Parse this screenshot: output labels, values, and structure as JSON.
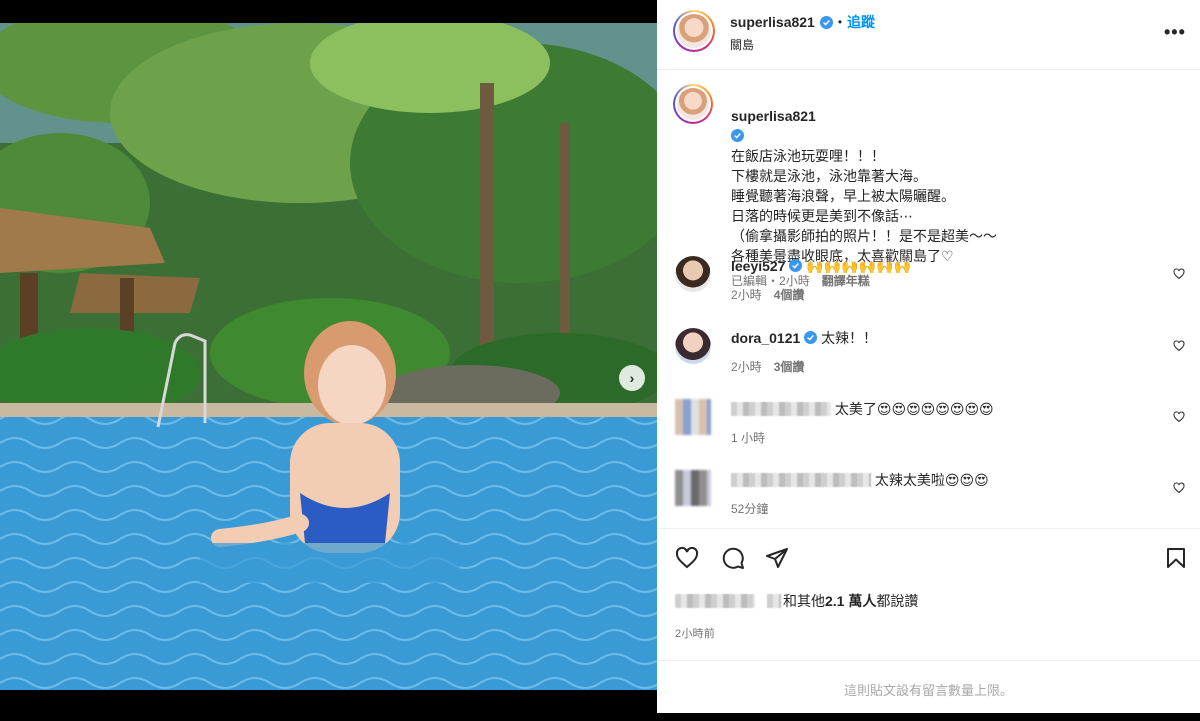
{
  "author": {
    "username": "superlisa821",
    "follow_label": "追蹤",
    "location": "關島",
    "more_label": "•••"
  },
  "caption": {
    "username": "superlisa821",
    "text": "在飯店泳池玩耍哩！！！\n下樓就是泳池，泳池靠著大海。\n睡覺聽著海浪聲，早上被太陽曬醒。\n日落的時候更是美到不像話⋯\n（偷拿攝影師拍的照片！！是不是超美～～\n各種美景盡收眼底，太喜歡關島了♡",
    "edited": "已編輯",
    "time": "2小時",
    "translate": "翻譯年糕"
  },
  "comments": [
    {
      "username": "leeyi527",
      "text": "🙌🙌🙌🙌🙌🙌",
      "time": "2小時",
      "likes": "4個讚"
    },
    {
      "username": "dora_0121",
      "text": "太辣！！",
      "time": "2小時",
      "likes": "3個讚"
    },
    {
      "username": "",
      "text": "太美了😍😍😍😍😍😍😍😍",
      "time": "1 小時",
      "likes": ""
    },
    {
      "username": "",
      "text": "太辣太美啦😍😍😍",
      "time": "52分鐘",
      "likes": ""
    }
  ],
  "actions": {
    "likes_text": "和其他",
    "likes_count": "2.1 萬人",
    "likes_suffix": "都說讚",
    "time_ago": "2小時前"
  },
  "footer": {
    "limit_text": "這則貼文設有留言數量上限。"
  },
  "carousel": {
    "next_label": "›",
    "total_slides": 3,
    "active_slide": 1
  },
  "colors": {
    "accent": "#0095f6",
    "verified": "#3897f0"
  }
}
